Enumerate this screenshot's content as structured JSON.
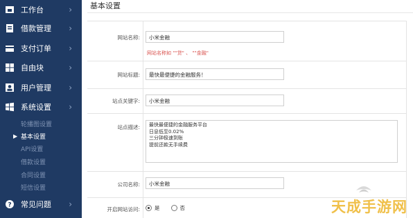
{
  "sidebar": {
    "items": [
      {
        "label": "工作台",
        "icon": "home-icon"
      },
      {
        "label": "借款管理",
        "icon": "document-icon"
      },
      {
        "label": "支付订单",
        "icon": "card-icon"
      },
      {
        "label": "自由块",
        "icon": "grid-icon"
      },
      {
        "label": "用户管理",
        "icon": "user-icon"
      },
      {
        "label": "系统设置",
        "icon": "windows-icon"
      }
    ],
    "submenu": [
      {
        "label": "轮播图设置"
      },
      {
        "label": "基本设置",
        "active": true
      },
      {
        "label": "API设置"
      },
      {
        "label": "借款设置"
      },
      {
        "label": "合同设置"
      },
      {
        "label": "短信设置"
      }
    ],
    "faq": {
      "label": "常见问题",
      "icon": "help-icon"
    }
  },
  "main": {
    "title": "基本设置",
    "form": {
      "site_name_label": "网站名称:",
      "site_name_value": "小米金融",
      "site_name_hint": "网站名称如 \"\"贷\" 、 \"\"金融\"",
      "site_title_label": "网站标题:",
      "site_title_value": "最快最便捷的金融服务！",
      "keywords_label": "站点关键字:",
      "keywords_value": "小米金融",
      "description_label": "站点描述:",
      "description_lines": [
        "最快最便捷的金融服务平台",
        "日息低至0.02%",
        "三分钟极速到账",
        "提前还款无手续费"
      ],
      "company_label": "公司名称:",
      "company_value": "小米金融",
      "open_label": "开启网站访问:",
      "open_yes": "是",
      "open_no": "否"
    }
  },
  "watermark": "天成手游网",
  "colors": {
    "sidebar": "#1f3a63",
    "hint": "#d9534f",
    "watermark": "#f0c04a"
  }
}
